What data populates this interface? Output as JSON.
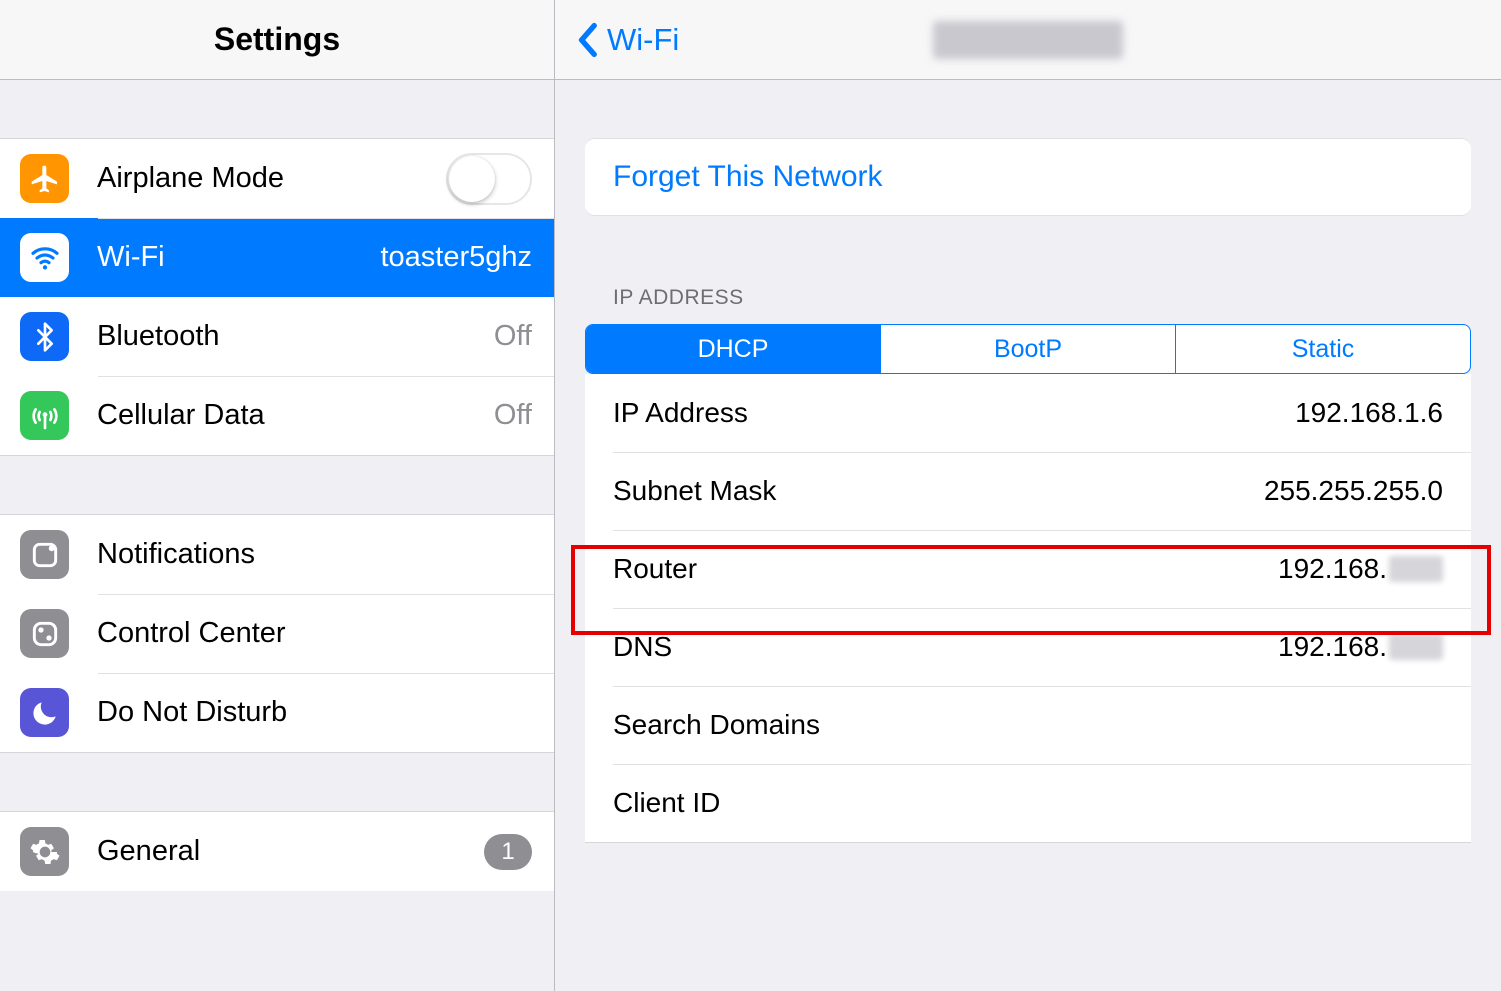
{
  "sidebar": {
    "title": "Settings",
    "group1": [
      {
        "label": "Airplane Mode",
        "kind": "toggle"
      },
      {
        "label": "Wi-Fi",
        "value": "toaster5ghz",
        "selected": true
      },
      {
        "label": "Bluetooth",
        "value": "Off"
      },
      {
        "label": "Cellular Data",
        "value": "Off"
      }
    ],
    "group2": [
      {
        "label": "Notifications"
      },
      {
        "label": "Control Center"
      },
      {
        "label": "Do Not Disturb"
      }
    ],
    "group3": [
      {
        "label": "General",
        "badge": "1"
      }
    ]
  },
  "detail": {
    "back_label": "Wi-Fi",
    "forget_label": "Forget This Network",
    "ip_section_label": "IP ADDRESS",
    "segments": {
      "dhcp": "DHCP",
      "bootp": "BootP",
      "static": "Static"
    },
    "fields": {
      "ip_address_label": "IP Address",
      "ip_address_value": "192.168.1.6",
      "subnet_label": "Subnet Mask",
      "subnet_value": "255.255.255.0",
      "router_label": "Router",
      "router_value": "192.168.",
      "dns_label": "DNS",
      "dns_value": "192.168.",
      "search_domains_label": "Search Domains",
      "client_id_label": "Client ID"
    }
  }
}
